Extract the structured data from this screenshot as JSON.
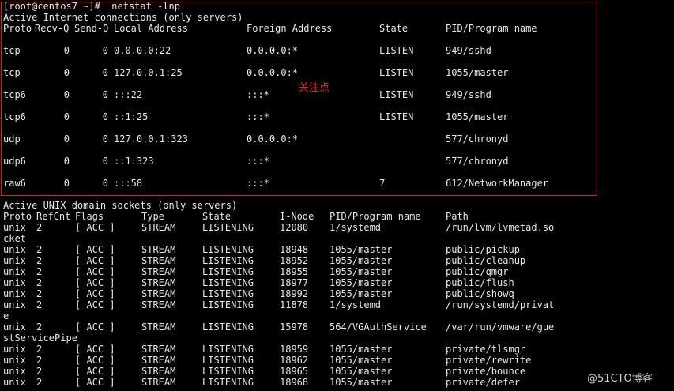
{
  "prompt": "[root@centos7 ~]#  netstat -lnp",
  "internet": {
    "title": "Active Internet connections (only servers)",
    "headers": [
      "Proto",
      "Recv-Q",
      "Send-Q",
      "Local Address",
      "Foreign Address",
      "State",
      "PID/Program name"
    ],
    "rows": [
      [
        "tcp",
        "0",
        "0",
        "0.0.0.0:22",
        "0.0.0.0:*",
        "LISTEN",
        "949/sshd"
      ],
      [
        "tcp",
        "0",
        "0",
        "127.0.0.1:25",
        "0.0.0.0:*",
        "LISTEN",
        "1055/master"
      ],
      [
        "tcp6",
        "0",
        "0",
        ":::22",
        ":::*",
        "LISTEN",
        "949/sshd"
      ],
      [
        "tcp6",
        "0",
        "0",
        "::1:25",
        ":::*",
        "LISTEN",
        "1055/master"
      ],
      [
        "udp",
        "0",
        "0",
        "127.0.0.1:323",
        "0.0.0.0:*",
        "",
        "577/chronyd"
      ],
      [
        "udp6",
        "0",
        "0",
        "::1:323",
        ":::*",
        "",
        "577/chronyd"
      ],
      [
        "raw6",
        "0",
        "0",
        ":::58",
        ":::*",
        "7",
        "612/NetworkManager"
      ]
    ]
  },
  "annotation": "关注点",
  "unix": {
    "title": "Active UNIX domain sockets (only servers)",
    "headers": [
      "Proto",
      "RefCnt",
      "Flags",
      "Type",
      "State",
      "I-Node",
      "PID/Program name",
      "Path"
    ],
    "rows": [
      [
        "unix",
        "2",
        "[ ACC ]",
        "STREAM",
        "LISTENING",
        "12080",
        "1/systemd",
        "/run/lvm/lvmetad.so"
      ],
      [
        "cket"
      ],
      [
        "unix",
        "2",
        "[ ACC ]",
        "STREAM",
        "LISTENING",
        "18948",
        "1055/master",
        "public/pickup"
      ],
      [
        "unix",
        "2",
        "[ ACC ]",
        "STREAM",
        "LISTENING",
        "18952",
        "1055/master",
        "public/cleanup"
      ],
      [
        "unix",
        "2",
        "[ ACC ]",
        "STREAM",
        "LISTENING",
        "18955",
        "1055/master",
        "public/qmgr"
      ],
      [
        "unix",
        "2",
        "[ ACC ]",
        "STREAM",
        "LISTENING",
        "18977",
        "1055/master",
        "public/flush"
      ],
      [
        "unix",
        "2",
        "[ ACC ]",
        "STREAM",
        "LISTENING",
        "18992",
        "1055/master",
        "public/showq"
      ],
      [
        "unix",
        "2",
        "[ ACC ]",
        "STREAM",
        "LISTENING",
        "11878",
        "1/systemd",
        "/run/systemd/privat"
      ],
      [
        "e"
      ],
      [
        "unix",
        "2",
        "[ ACC ]",
        "STREAM",
        "LISTENING",
        "15978",
        "564/VGAuthService",
        "/var/run/vmware/gue"
      ],
      [
        "stServicePipe"
      ],
      [
        "unix",
        "2",
        "[ ACC ]",
        "STREAM",
        "LISTENING",
        "18959",
        "1055/master",
        "private/tlsmgr"
      ],
      [
        "unix",
        "2",
        "[ ACC ]",
        "STREAM",
        "LISTENING",
        "18962",
        "1055/master",
        "private/rewrite"
      ],
      [
        "unix",
        "2",
        "[ ACC ]",
        "STREAM",
        "LISTENING",
        "18965",
        "1055/master",
        "private/bounce"
      ],
      [
        "unix",
        "2",
        "[ ACC ]",
        "STREAM",
        "LISTENING",
        "18968",
        "1055/master",
        "private/defer"
      ]
    ]
  },
  "watermark": "@51CTO博客"
}
